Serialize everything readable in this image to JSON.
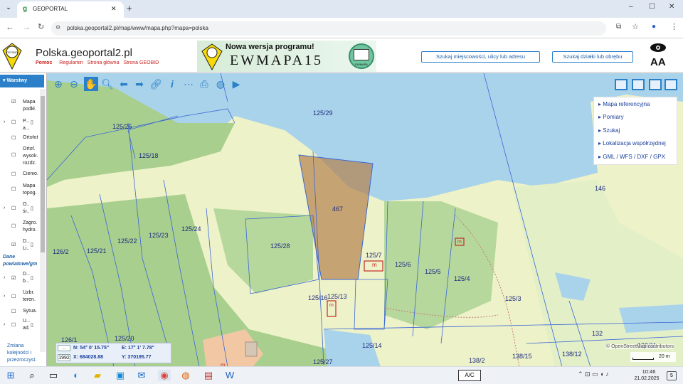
{
  "browser": {
    "tab_title": "GEOPORTAL",
    "url": "polska.geoportal2.pl/map/www/mapa.php?mapa=polska",
    "new_tab_label": "+",
    "window_controls": [
      "–",
      "☐",
      "✕"
    ]
  },
  "header": {
    "site_title": "Polska.geoportal2.pl",
    "nav": [
      "Pomoc",
      "Regulamin",
      "Strona główna",
      "Strona GEOBID"
    ],
    "logo_text": "GEOBID",
    "banner_top": "Nowa wersja programu!",
    "banner_main": "EWMAPA15",
    "banner_badge": "EWMAPA",
    "search_address_label": "Szukaj miejscowości, ulicy lub adresu",
    "search_parcel_label": "Szukaj działki lub obrębu",
    "accessibility_label": "AA"
  },
  "sidebar": {
    "tab_label": "Warstwy",
    "items": [
      {
        "label": "Mapa podkł.",
        "checked": true
      },
      {
        "label": "P... a...",
        "checked": false
      },
      {
        "label": "Ortofot.",
        "checked": false
      },
      {
        "label": "Ortof. wysok. rozdz.",
        "checked": false
      },
      {
        "label": "Cienio.",
        "checked": false
      },
      {
        "label": "Mapa topog.",
        "checked": false
      },
      {
        "label": "O... śr...",
        "checked": false
      },
      {
        "label": "Zagro. hydro.",
        "checked": false
      },
      {
        "label": "D... Li...",
        "checked": true
      },
      {
        "label": "Dane powiatowe/gm",
        "checked": null
      },
      {
        "label": "D... b...",
        "checked": true
      },
      {
        "label": "Uzbr. teren.",
        "checked": false
      },
      {
        "label": "Sytua.",
        "checked": false
      },
      {
        "label": "U... ad...",
        "checked": false
      }
    ],
    "footer_link": "Zmiana kolejności i przezroczyst."
  },
  "right_panel": {
    "items": [
      "Mapa referencyjna",
      "Pomiary",
      "Szukaj",
      "Lokalizacja współrzędnej",
      "GML / WFS / DXF / GPX"
    ]
  },
  "map": {
    "parcel_labels": [
      "125/29",
      "125/25",
      "125/18",
      "467",
      "146",
      "125/28",
      "125/24",
      "125/23",
      "125/22",
      "125/21",
      "126/2",
      "125/7",
      "125/6",
      "125/5",
      "125/4",
      "125/3",
      "125/16",
      "125/13",
      "125/14",
      "125/20",
      "126/1",
      "125/27",
      "138/2",
      "138/15",
      "138/12",
      "132",
      "138/11"
    ],
    "building_marks": [
      "m",
      "m",
      "m",
      "m"
    ],
    "attribution": "© OpenStreetMap contributors",
    "scale_label": "20 m"
  },
  "coords": {
    "crs_1": "...",
    "crs_2": "1992",
    "n": "N: 54° 0' 15.75\"",
    "e": "E: 17° 1' 7.78\"",
    "x": "X: 684028.88",
    "y": "Y: 370195.77"
  },
  "taskbar": {
    "ime": "A/C",
    "time": "10:46",
    "date": "21.02.2025",
    "notif": "5"
  },
  "colors": {
    "lake": "#a9d3ea",
    "forest": "#a8cf8e",
    "field": "#eef2c8",
    "parcel_line": "#3b67d6",
    "highlight": "#b5814d",
    "accent": "#2b80c9"
  }
}
